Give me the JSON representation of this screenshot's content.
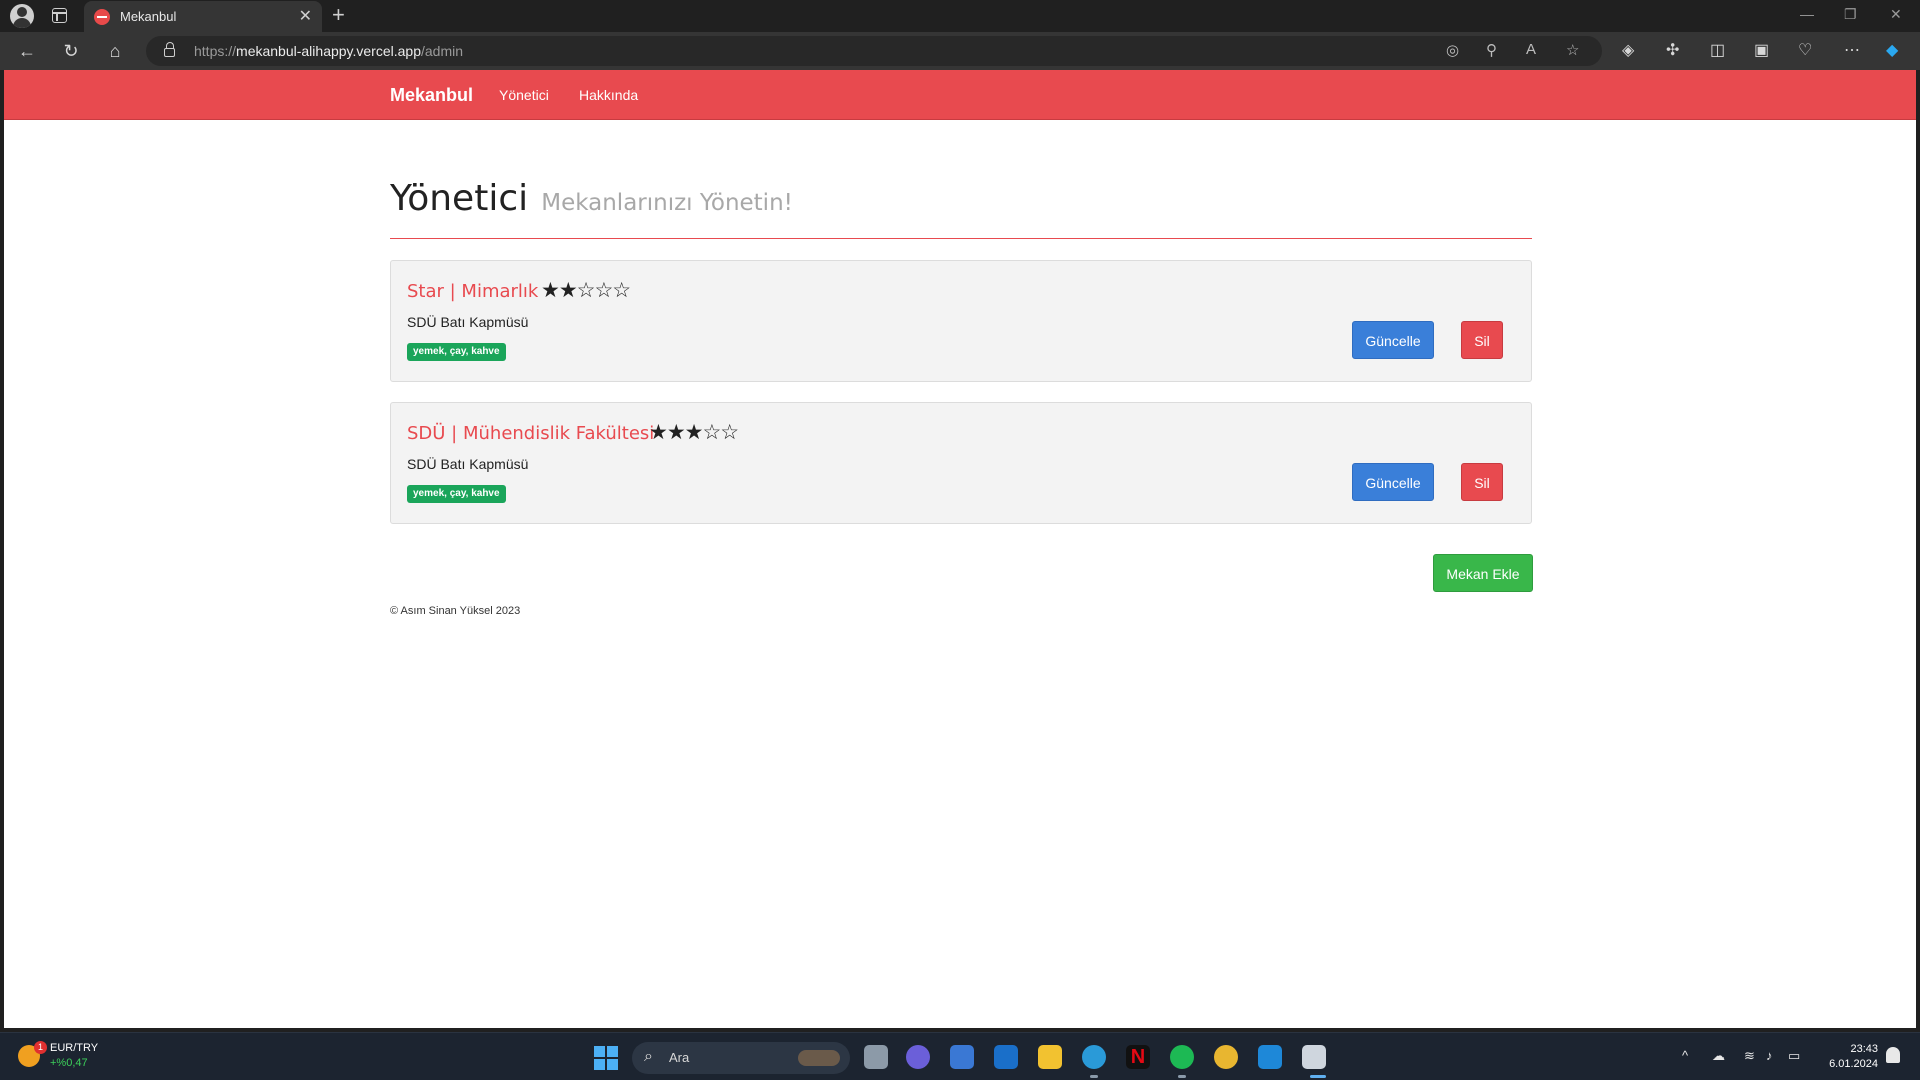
{
  "browser": {
    "tab_title": "Mekanbul",
    "tab_close": "✕",
    "new_tab": "+",
    "url_prefix": "https://",
    "url_host": "mekanbul-alihappy.vercel.app",
    "url_path": "/admin"
  },
  "site": {
    "brand": "Mekanbul",
    "nav": [
      {
        "label": "Yönetici"
      },
      {
        "label": "Hakkında"
      }
    ]
  },
  "page": {
    "title": "Yönetici",
    "subtitle": "Mekanlarınızı Yönetin!"
  },
  "venues": [
    {
      "name": "Star | Mimarlık",
      "rating": 2,
      "stars": "★★☆☆☆",
      "address": "SDÜ Batı Kapmüsü",
      "tags": "yemek, çay, kahve",
      "update_label": "Güncelle",
      "delete_label": "Sil"
    },
    {
      "name": "SDÜ | Mühendislik Fakültesi",
      "rating": 3,
      "stars": "★★★☆☆",
      "address": "SDÜ Batı Kapmüsü",
      "tags": "yemek, çay, kahve",
      "update_label": "Güncelle",
      "delete_label": "Sil"
    }
  ],
  "add_button": "Mekan Ekle",
  "footer": "© Asım Sinan Yüksel 2023",
  "taskbar": {
    "widget_label": "EUR/TRY",
    "widget_change": "+%0,47",
    "widget_badge": "1",
    "search_placeholder": "Ara",
    "time": "23:43",
    "date": "6.01.2024"
  },
  "colors": {
    "brand_red": "#e84a4f",
    "update_blue": "#3a7fd9",
    "add_green": "#39b74a",
    "tag_green": "#1aa55a"
  }
}
